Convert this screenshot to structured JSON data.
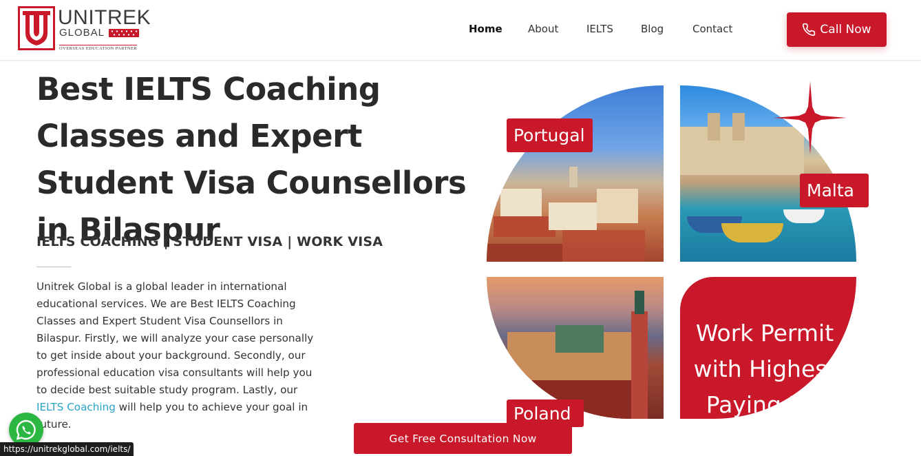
{
  "brand": {
    "name": "UNITREK",
    "sub": "GLOBAL",
    "tagline": "OVERSEAS EDUCATION PARTNER",
    "accent": "#c8182a"
  },
  "nav": {
    "items": [
      {
        "label": "Home",
        "active": true
      },
      {
        "label": "About",
        "active": false
      },
      {
        "label": "IELTS",
        "active": false
      },
      {
        "label": "Blog",
        "active": false
      },
      {
        "label": "Contact",
        "active": false
      }
    ],
    "cta_label": "Call Now",
    "cta_icon": "phone-icon"
  },
  "hero": {
    "title": "Best IELTS Coaching Classes and Expert Student Visa Counsellors in Bilaspur",
    "subtitle": "IELTS COACHING | STUDENT VISA | WORK VISA",
    "body_before_link": "Unitrek Global is a global leader in international educational services. We are Best IELTS Coaching Classes and Expert Student Visa Counsellors in Bilaspur. Firstly, we will analyze your case personally to get inside about your background. Secondly, our professional education visa consultants will help you to decide best suitable study program. Lastly, our ",
    "body_link": "IELTS Coaching",
    "body_after_link": " will help you to achieve your goal in future.",
    "link_color": "#2aa3c9"
  },
  "collage": {
    "tags": [
      "Portugal",
      "Malta",
      "Poland"
    ],
    "work_text": "Work Permit with Highest Paying Job"
  },
  "consult_button": "Get Free Consultation Now",
  "whatsapp_icon": "whatsapp-icon",
  "status_bar": {
    "url": "https://unitrekglobal.com/ielts/"
  }
}
